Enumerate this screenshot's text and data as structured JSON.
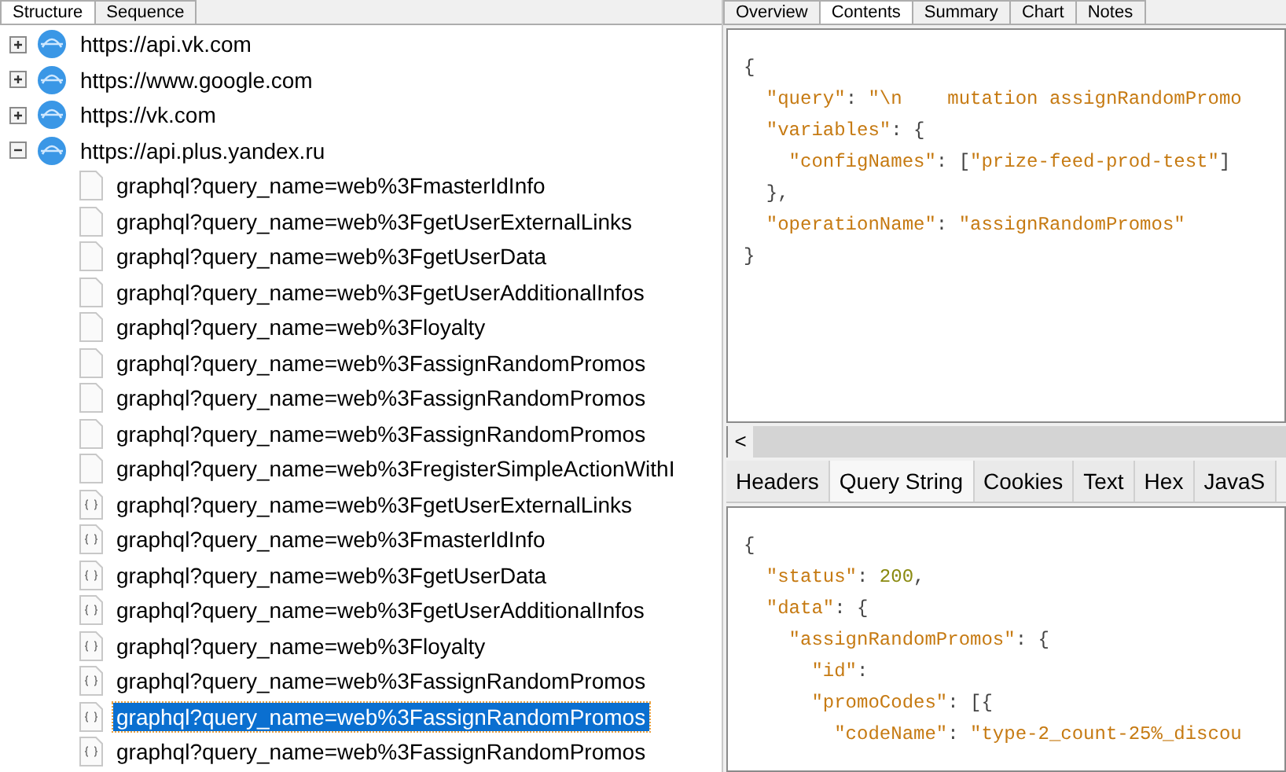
{
  "left_panel": {
    "tabs": [
      {
        "label": "Structure",
        "selected": true
      },
      {
        "label": "Sequence",
        "selected": false
      }
    ],
    "tree": [
      {
        "label": "https://api.vk.com",
        "expanded": false
      },
      {
        "label": "https://www.google.com",
        "expanded": false
      },
      {
        "label": "https://vk.com",
        "expanded": false
      },
      {
        "label": "https://api.plus.yandex.ru",
        "expanded": true,
        "children": [
          {
            "label": "graphql?query_name=web%3FmasterIdInfo",
            "kind": "page",
            "selected": false
          },
          {
            "label": "graphql?query_name=web%3FgetUserExternalLinks",
            "kind": "page",
            "selected": false
          },
          {
            "label": "graphql?query_name=web%3FgetUserData",
            "kind": "page",
            "selected": false
          },
          {
            "label": "graphql?query_name=web%3FgetUserAdditionalInfos",
            "kind": "page",
            "selected": false
          },
          {
            "label": "graphql?query_name=web%3Floyalty",
            "kind": "page",
            "selected": false
          },
          {
            "label": "graphql?query_name=web%3FassignRandomPromos",
            "kind": "page",
            "selected": false
          },
          {
            "label": "graphql?query_name=web%3FassignRandomPromos",
            "kind": "page",
            "selected": false
          },
          {
            "label": "graphql?query_name=web%3FassignRandomPromos",
            "kind": "page",
            "selected": false
          },
          {
            "label": "graphql?query_name=web%3FregisterSimpleActionWithI",
            "kind": "page",
            "selected": false
          },
          {
            "label": "graphql?query_name=web%3FgetUserExternalLinks",
            "kind": "json",
            "selected": false
          },
          {
            "label": "graphql?query_name=web%3FmasterIdInfo",
            "kind": "json",
            "selected": false
          },
          {
            "label": "graphql?query_name=web%3FgetUserData",
            "kind": "json",
            "selected": false
          },
          {
            "label": "graphql?query_name=web%3FgetUserAdditionalInfos",
            "kind": "json",
            "selected": false
          },
          {
            "label": "graphql?query_name=web%3Floyalty",
            "kind": "json",
            "selected": false
          },
          {
            "label": "graphql?query_name=web%3FassignRandomPromos",
            "kind": "json",
            "selected": false
          },
          {
            "label": "graphql?query_name=web%3FassignRandomPromos",
            "kind": "json",
            "selected": true
          },
          {
            "label": "graphql?query_name=web%3FassignRandomPromos",
            "kind": "json",
            "selected": false
          }
        ]
      }
    ]
  },
  "right_panel": {
    "tabs": [
      {
        "label": "Overview",
        "selected": false
      },
      {
        "label": "Contents",
        "selected": true
      },
      {
        "label": "Summary",
        "selected": false
      },
      {
        "label": "Chart",
        "selected": false
      },
      {
        "label": "Notes",
        "selected": false
      }
    ],
    "request_body": [
      [
        {
          "text": "{",
          "kind": "punct"
        }
      ],
      [
        {
          "text": "  \"query\"",
          "kind": "key"
        },
        {
          "text": ": ",
          "kind": "punct"
        },
        {
          "text": "\"\\n    mutation assignRandomPromo",
          "kind": "string"
        }
      ],
      [
        {
          "text": "  \"variables\"",
          "kind": "key"
        },
        {
          "text": ": {",
          "kind": "punct"
        }
      ],
      [
        {
          "text": "    \"configNames\"",
          "kind": "key"
        },
        {
          "text": ": [",
          "kind": "punct"
        },
        {
          "text": "\"prize-feed-prod-test\"",
          "kind": "string"
        },
        {
          "text": "]",
          "kind": "punct"
        }
      ],
      [
        {
          "text": "  },",
          "kind": "punct"
        }
      ],
      [
        {
          "text": "  \"operationName\"",
          "kind": "key"
        },
        {
          "text": ": ",
          "kind": "punct"
        },
        {
          "text": "\"assignRandomPromos\"",
          "kind": "string"
        }
      ],
      [
        {
          "text": "}",
          "kind": "punct"
        }
      ]
    ],
    "scroll_left": "<",
    "response_tabs": [
      {
        "label": "Headers",
        "selected": false
      },
      {
        "label": "Query String",
        "selected": true
      },
      {
        "label": "Cookies",
        "selected": false
      },
      {
        "label": "Text",
        "selected": false
      },
      {
        "label": "Hex",
        "selected": false
      },
      {
        "label": "JavaS",
        "selected": false
      }
    ],
    "response_body": [
      [
        {
          "text": "{",
          "kind": "punct"
        }
      ],
      [
        {
          "text": "  \"status\"",
          "kind": "key"
        },
        {
          "text": ": ",
          "kind": "punct"
        },
        {
          "text": "200",
          "kind": "number"
        },
        {
          "text": ",",
          "kind": "punct"
        }
      ],
      [
        {
          "text": "  \"data\"",
          "kind": "key"
        },
        {
          "text": ": {",
          "kind": "punct"
        }
      ],
      [
        {
          "text": "    \"assignRandomPromos\"",
          "kind": "key"
        },
        {
          "text": ": {",
          "kind": "punct"
        }
      ],
      [
        {
          "text": "      \"id\"",
          "kind": "key"
        },
        {
          "text": ":",
          "kind": "punct"
        }
      ],
      [
        {
          "text": "      \"promoCodes\"",
          "kind": "key"
        },
        {
          "text": ": [{",
          "kind": "punct"
        }
      ],
      [
        {
          "text": "        \"codeName\"",
          "kind": "key"
        },
        {
          "text": ": ",
          "kind": "punct"
        },
        {
          "text": "\"type-2_count-25%_discou",
          "kind": "string"
        }
      ]
    ]
  }
}
